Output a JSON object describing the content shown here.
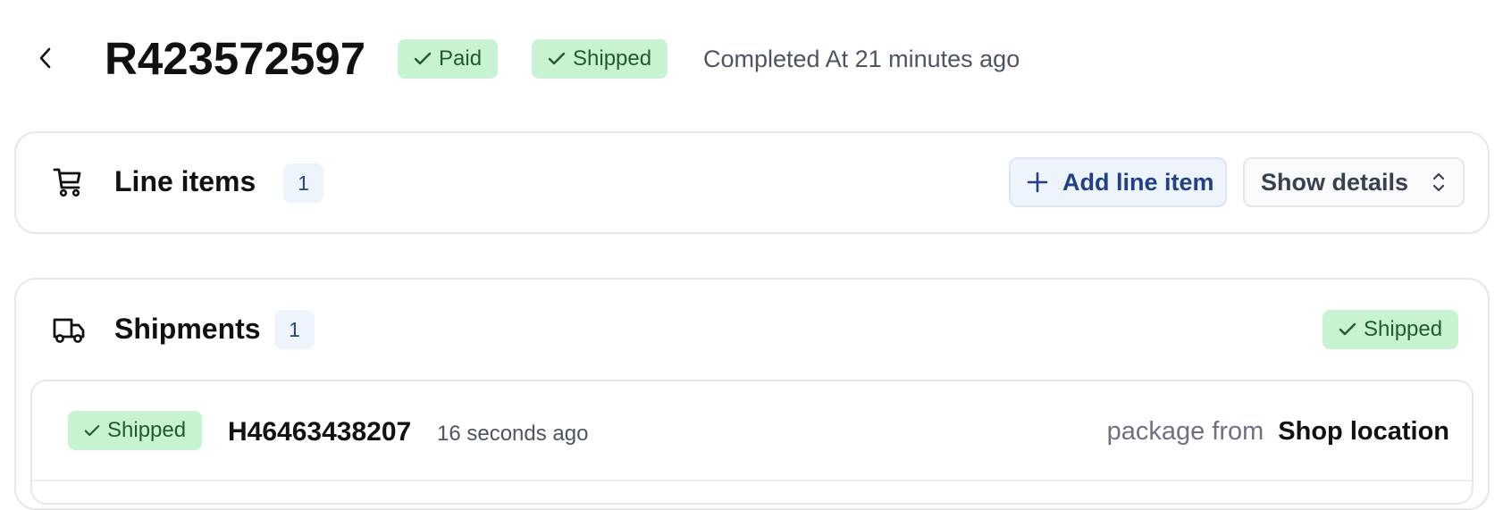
{
  "header": {
    "order_number": "R423572597",
    "badges": [
      {
        "label": "Paid",
        "icon": "check-icon"
      },
      {
        "label": "Shipped",
        "icon": "check-icon"
      }
    ],
    "completed_text": "Completed At 21 minutes ago"
  },
  "line_items": {
    "title": "Line items",
    "count": "1",
    "add_button_label": "Add line item",
    "details_button_label": "Show details",
    "icon": "cart-icon"
  },
  "shipments": {
    "title": "Shipments",
    "count": "1",
    "status_badge": "Shipped",
    "icon": "truck-icon",
    "items": [
      {
        "status": "Shipped",
        "tracking": "H46463438207",
        "time_ago": "16 seconds ago",
        "from_label": "package from",
        "location": "Shop location"
      }
    ]
  },
  "colors": {
    "success_bg": "#c8f3d3",
    "success_text": "#1f5a34",
    "accent_bg": "#eef4fc",
    "accent_text": "#22408a"
  }
}
